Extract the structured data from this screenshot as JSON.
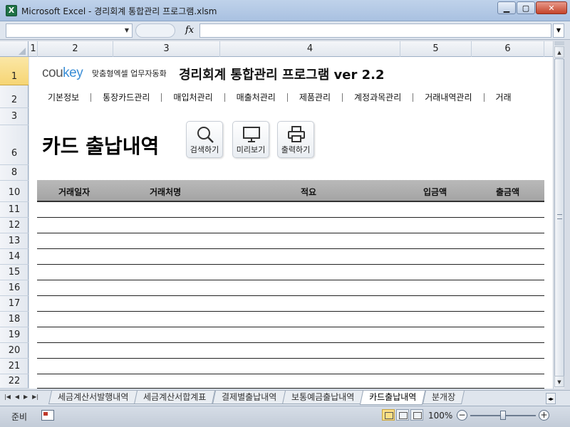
{
  "window": {
    "title": "Microsoft Excel - 경리회계 통합관리 프로그램.xlsm",
    "app_icon": "excel-icon",
    "controls": [
      "minimize",
      "restore",
      "close"
    ]
  },
  "formula_bar": {
    "name_box": "",
    "fx_label": "fx",
    "formula": ""
  },
  "columns": [
    "1",
    "2",
    "3",
    "4",
    "5",
    "6"
  ],
  "rows": [
    "1",
    "2",
    "3",
    "6",
    "8",
    "10",
    "11",
    "12",
    "13",
    "14",
    "15",
    "16",
    "17",
    "18",
    "19",
    "20",
    "21",
    "22"
  ],
  "active_row": "1",
  "header": {
    "logo_prefix": "cou",
    "logo_accent": "key",
    "logo_sub": "맞춤형엑셀 업무자동화",
    "title": "경리회계 통합관리 프로그램 ver 2.2"
  },
  "nav": [
    "기본정보",
    "통장카드관리",
    "매입처관리",
    "매출처관리",
    "제품관리",
    "계정과목관리",
    "거래내역관리",
    "거래"
  ],
  "page": {
    "title": "카드 출납내역"
  },
  "tools": {
    "search": "검색하기",
    "preview": "미리보기",
    "print": "출력하기"
  },
  "table": {
    "headers": [
      "거래일자",
      "거래처명",
      "적요",
      "입금액",
      "출금액"
    ],
    "rows": [
      [],
      [],
      [],
      [],
      [],
      [],
      [],
      [],
      [],
      [],
      [],
      []
    ]
  },
  "sheet_tabs": [
    "세금계산서발행내역",
    "세금계산서합계표",
    "결제별출납내역",
    "보통예금출납내역",
    "카드출납내역",
    "분개장"
  ],
  "active_tab": "카드출납내역",
  "status": {
    "mode": "준비",
    "zoom": "100%"
  },
  "colors": {
    "table_header": "#a9a9a9",
    "logo_accent": "#3b8ed6",
    "active_row_header": "#f6d574"
  }
}
